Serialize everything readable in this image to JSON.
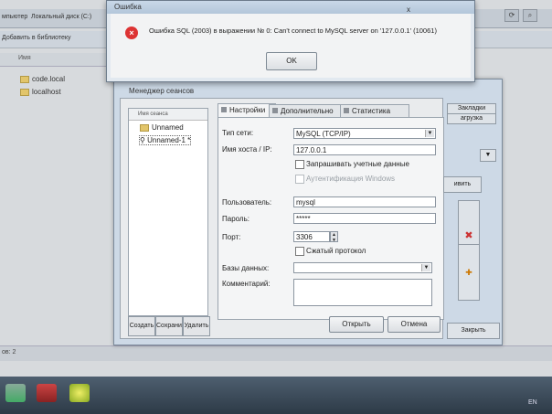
{
  "explorer": {
    "address": [
      "мпьютер",
      "Локальный диск (C:)"
    ],
    "toolbar_left": "Добавить в библиотеку",
    "column_name": "Имя",
    "files": [
      "code.local",
      "localhost"
    ],
    "status": "ов: 2"
  },
  "error": {
    "title": "Ошибка",
    "message": "Ошибка SQL (2003) в выражении № 0: Can't connect to MySQL server on '127.0.0.1' (10061)",
    "ok_label": "OK",
    "close_glyph": "x"
  },
  "manager": {
    "title": "Менеджер сеансов",
    "tree_header": "Имя сеанса",
    "sessions": [
      "Unnamed",
      "Unnamed-1 *"
    ],
    "left_buttons": [
      "Создать",
      "Сохранить",
      "Удалить"
    ],
    "tabs": [
      "Настройки",
      "Дополнительно",
      "Статистика"
    ],
    "form": {
      "network_type_label": "Тип сети:",
      "network_type_value": "MySQL (TCP/IP)",
      "host_label": "Имя хоста / IP:",
      "host_value": "127.0.0.1",
      "prompt_credentials": "Запрашивать учетные данные",
      "windows_auth": "Аутентификация Windows",
      "user_label": "Пользователь:",
      "user_value": "mysql",
      "password_label": "Пароль:",
      "password_value": "*****",
      "port_label": "Порт:",
      "port_value": "3306",
      "compressed": "Сжатый протокол",
      "databases_label": "Базы данных:",
      "comment_label": "Комментарий:"
    },
    "open_label": "Открыть",
    "cancel_label": "Отмена",
    "right_tabs": [
      "Закладки",
      "агрузка"
    ],
    "right_btn": "ивить",
    "close_label": "Закрыть"
  },
  "taskbar": {
    "lang": "EN"
  }
}
